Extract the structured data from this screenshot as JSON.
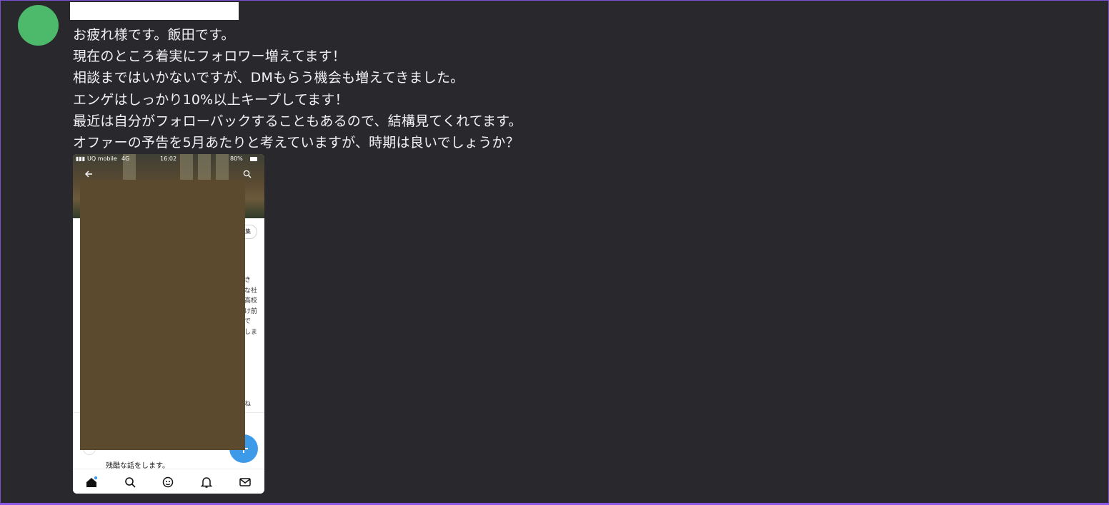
{
  "message": {
    "lines": [
      "お疲れ様です。飯田です。",
      "現在のところ着実にフォロワー増えてます！",
      "相談まではいかないですが、DMもらう機会も増えてきました。",
      "エンゲはしっかり10%以上キープしてます！",
      "最近は自分がフォローバックすることもあるので、結構見てくれてます。",
      "オファーの予告を5月あたりと考えていますが、時期は良いでしょうか？"
    ]
  },
  "colors": {
    "background": "#29282d",
    "avatar": "#4cb96b",
    "frame_border": "#8a56e6",
    "redaction": "#5c4a2e",
    "fab": "#3d9ae8"
  },
  "attachment": {
    "status_bar": {
      "carrier": "UQ mobile",
      "network": "4G",
      "time": "16:02",
      "battery": "80%"
    },
    "edit_button_label": "集",
    "right_text_fragments": "き\nな社\n高校\nけ前\nで\nしま",
    "ne_fragment": "ね",
    "tweet_text": "残酷な話をします。",
    "icons": {
      "back": "back-arrow-icon",
      "search": "search-icon",
      "compose": "plus-icon",
      "nav": [
        "home-icon",
        "search-icon",
        "grok-icon",
        "bell-icon",
        "mail-icon"
      ]
    }
  }
}
